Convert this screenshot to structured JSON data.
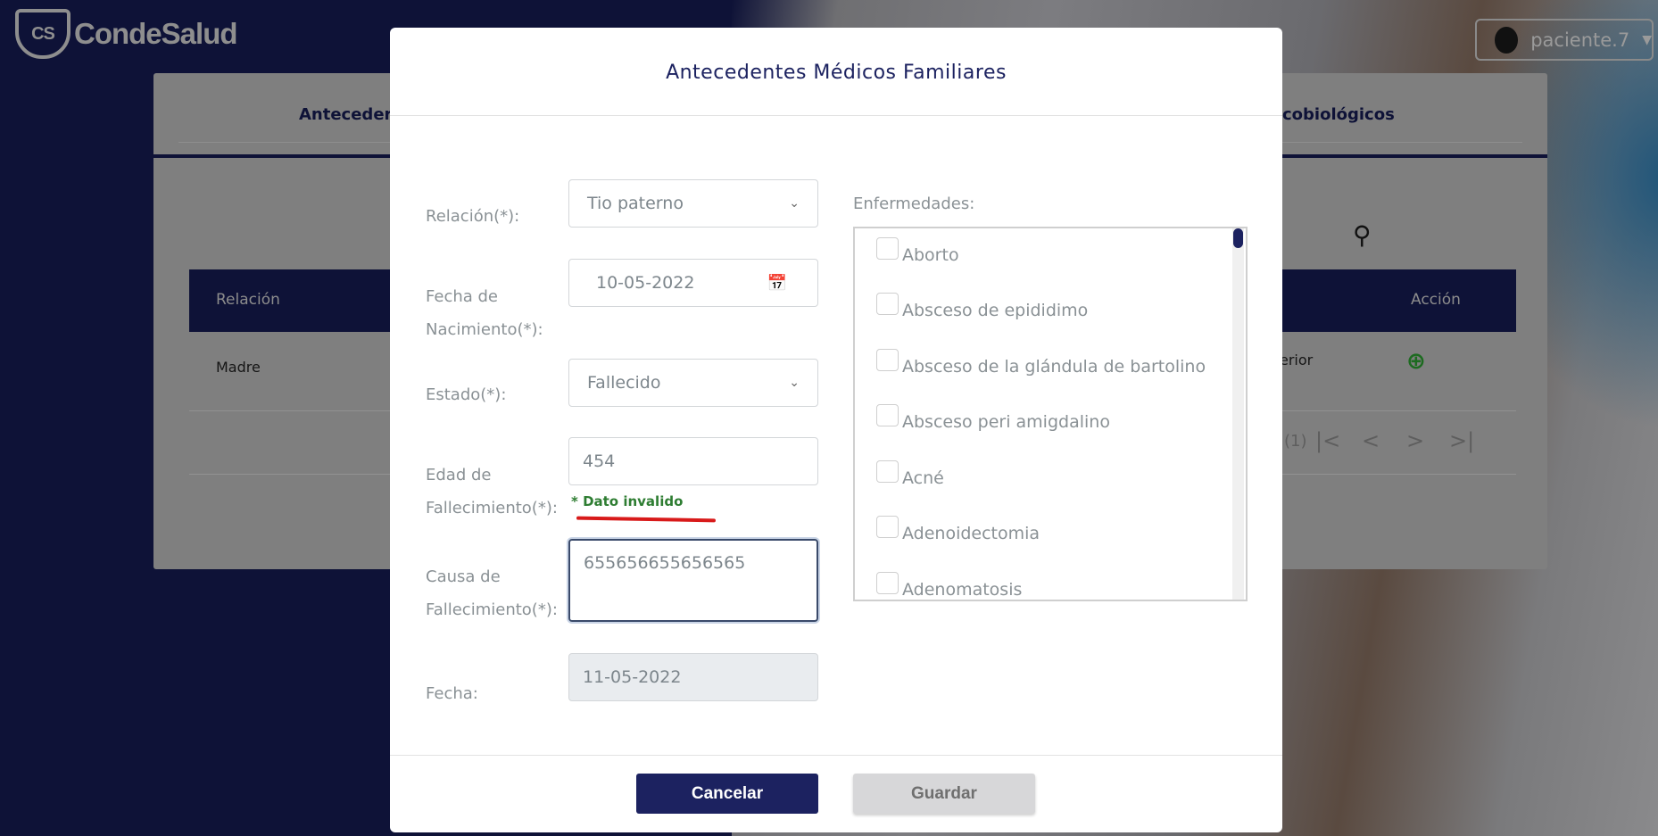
{
  "header": {
    "brand": "CondeSalud",
    "brand_mark": "CS",
    "user": "paciente.7"
  },
  "background": {
    "tabs": [
      "Anteceder",
      "cobiológicos"
    ],
    "table": {
      "headers": [
        "Relación",
        "Acción"
      ],
      "row": {
        "relacion": "Madre",
        "partial": "erior"
      }
    },
    "pager": {
      "count": "(1)",
      "first": "|<",
      "prev": "<",
      "next": ">",
      "last": ">|"
    }
  },
  "modal": {
    "title": "Antecedentes Médicos Familiares",
    "fields": {
      "relacion": {
        "label": "Relación(*):",
        "value": "Tio paterno"
      },
      "fecha_nac": {
        "label1": "Fecha de",
        "label2": "Nacimiento(*):",
        "value": "10-05-2022"
      },
      "estado": {
        "label": "Estado(*):",
        "value": "Fallecido"
      },
      "edad": {
        "label1": "Edad de",
        "label2": "Fallecimiento(*):",
        "value": "454",
        "error": "* Dato invalido"
      },
      "causa": {
        "label1": "Causa de",
        "label2": "Fallecimiento(*):",
        "value": "655656655656565"
      },
      "fecha": {
        "label": "Fecha:",
        "value": "11-05-2022"
      }
    },
    "enfermedades": {
      "label": "Enfermedades:",
      "items": [
        "Aborto",
        "Absceso de epididimo",
        "Absceso de la glándula de bartolino",
        "Absceso peri amigdalino",
        "Acné",
        "Adenoidectomia",
        "Adenomatosis"
      ]
    },
    "buttons": {
      "cancel": "Cancelar",
      "save": "Guardar"
    }
  },
  "colors": {
    "primary": "#1c2260",
    "error": "#2e7d32",
    "annotation": "#d81a1a"
  }
}
